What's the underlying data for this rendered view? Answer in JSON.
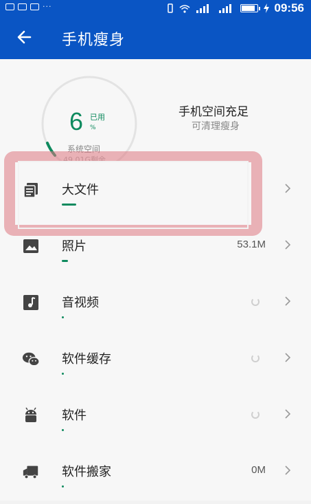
{
  "status_bar": {
    "time": "09:56",
    "icons": [
      "sim-icon",
      "bb-icon",
      "mail-icon",
      "more-dots",
      "vibrate-icon",
      "wifi-icon",
      "signal-icon-1",
      "signal-icon-2",
      "battery-icon",
      "charging-icon"
    ]
  },
  "header": {
    "title": "手机瘦身",
    "back_icon": "arrow-left-icon"
  },
  "storage": {
    "used_value": "6",
    "used_label": "已用",
    "percent_sign": "%",
    "system_space_label": "系统空间",
    "free_text": "49.01G剩余",
    "status_title": "手机空间充足",
    "status_subtitle": "可清理瘦身"
  },
  "items": [
    {
      "label": "大文件",
      "value": "",
      "loading": false,
      "icon": "stack-files-icon",
      "progress": 0.07
    },
    {
      "label": "照片",
      "value": "53.1M",
      "loading": false,
      "icon": "image-icon",
      "progress": 0.03
    },
    {
      "label": "音视频",
      "value": "",
      "loading": true,
      "icon": "music-note-icon",
      "progress": 0.005
    },
    {
      "label": "软件缓存",
      "value": "",
      "loading": true,
      "icon": "wechat-icon",
      "progress": 0.005
    },
    {
      "label": "软件",
      "value": "",
      "loading": true,
      "icon": "android-icon",
      "progress": 0.005
    },
    {
      "label": "软件搬家",
      "value": "0M",
      "loading": false,
      "icon": "truck-icon",
      "progress": 0.005
    }
  ],
  "colors": {
    "primary": "#0a55c4",
    "accent_green": "#0e8a5e",
    "highlight": "#de7882"
  }
}
